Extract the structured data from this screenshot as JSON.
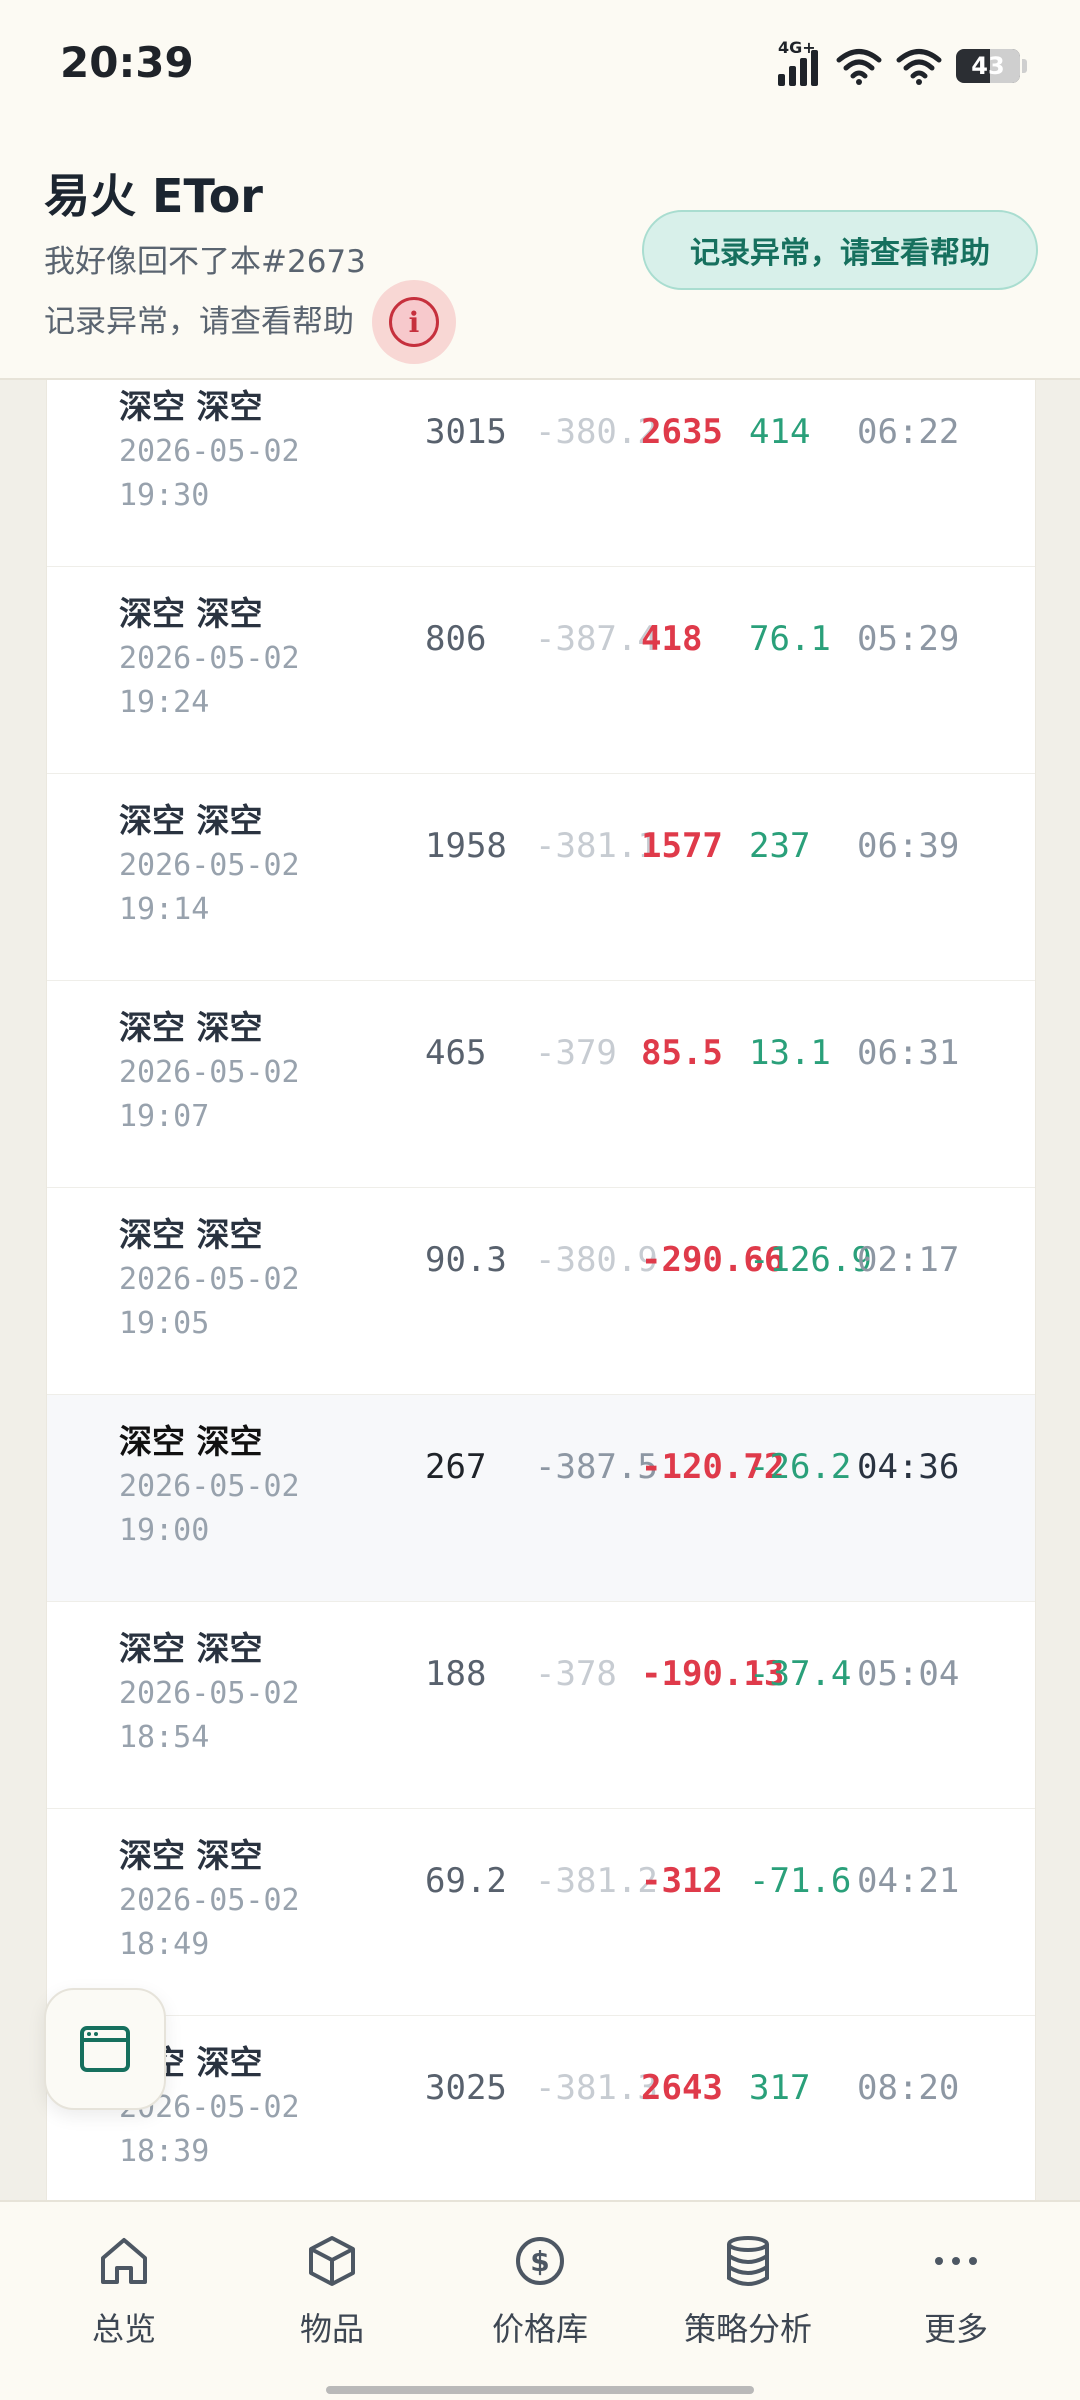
{
  "status_bar": {
    "time": "20:39",
    "network": "4G+",
    "battery": "43"
  },
  "header": {
    "title": "易火 ETor",
    "subtitle": "我好像回不了本#2673",
    "warning": "记录异常，请查看帮助",
    "help_button": "记录异常，请查看帮助",
    "info_icon": "info-circle-icon",
    "accent_color": "#16705e",
    "alert_color": "#c6303d"
  },
  "records": [
    {
      "name": "深空 深空",
      "date": "2026-05-02",
      "time": "19:30",
      "v1": "3015",
      "v2": "-380.2",
      "v3": "2635",
      "v4": "414",
      "duration": "06:22"
    },
    {
      "name": "深空 深空",
      "date": "2026-05-02",
      "time": "19:24",
      "v1": "806",
      "v2": "-387.4",
      "v3": "418",
      "v4": "76.1",
      "duration": "05:29"
    },
    {
      "name": "深空 深空",
      "date": "2026-05-02",
      "time": "19:14",
      "v1": "1958",
      "v2": "-381.1",
      "v3": "1577",
      "v4": "237",
      "duration": "06:39"
    },
    {
      "name": "深空 深空",
      "date": "2026-05-02",
      "time": "19:07",
      "v1": "465",
      "v2": "-379",
      "v3": "85.5",
      "v4": "13.1",
      "duration": "06:31"
    },
    {
      "name": "深空 深空",
      "date": "2026-05-02",
      "time": "19:05",
      "v1": "90.3",
      "v2": "-380.9",
      "v3": "-290.66",
      "v4": "-126.9",
      "duration": "02:17"
    },
    {
      "name": "深空 深空",
      "date": "2026-05-02",
      "time": "19:00",
      "v1": "267",
      "v2": "-387.5",
      "v3": "-120.72",
      "v4": "-26.2",
      "duration": "04:36"
    },
    {
      "name": "深空 深空",
      "date": "2026-05-02",
      "time": "18:54",
      "v1": "188",
      "v2": "-378",
      "v3": "-190.13",
      "v4": "-37.4",
      "duration": "05:04"
    },
    {
      "name": "深空 深空",
      "date": "2026-05-02",
      "time": "18:49",
      "v1": "69.2",
      "v2": "-381.2",
      "v3": "-312",
      "v4": "-71.6",
      "duration": "04:21"
    },
    {
      "name": "深空 深空",
      "date": "2026-05-02",
      "time": "18:39",
      "v1": "3025",
      "v2": "-381.3",
      "v3": "2643",
      "v4": "317",
      "duration": "08:20"
    }
  ],
  "colors": {
    "negative": "#df3a4a",
    "positive": "#2aa07a",
    "muted": "#c7ccd2"
  },
  "fab": {
    "icon": "browser-window-icon"
  },
  "bottom_nav": [
    {
      "label": "总览",
      "icon": "home-icon"
    },
    {
      "label": "物品",
      "icon": "cube-icon"
    },
    {
      "label": "价格库",
      "icon": "dollar-circle-icon"
    },
    {
      "label": "策略分析",
      "icon": "database-icon"
    },
    {
      "label": "更多",
      "icon": "more-dots-icon"
    }
  ]
}
